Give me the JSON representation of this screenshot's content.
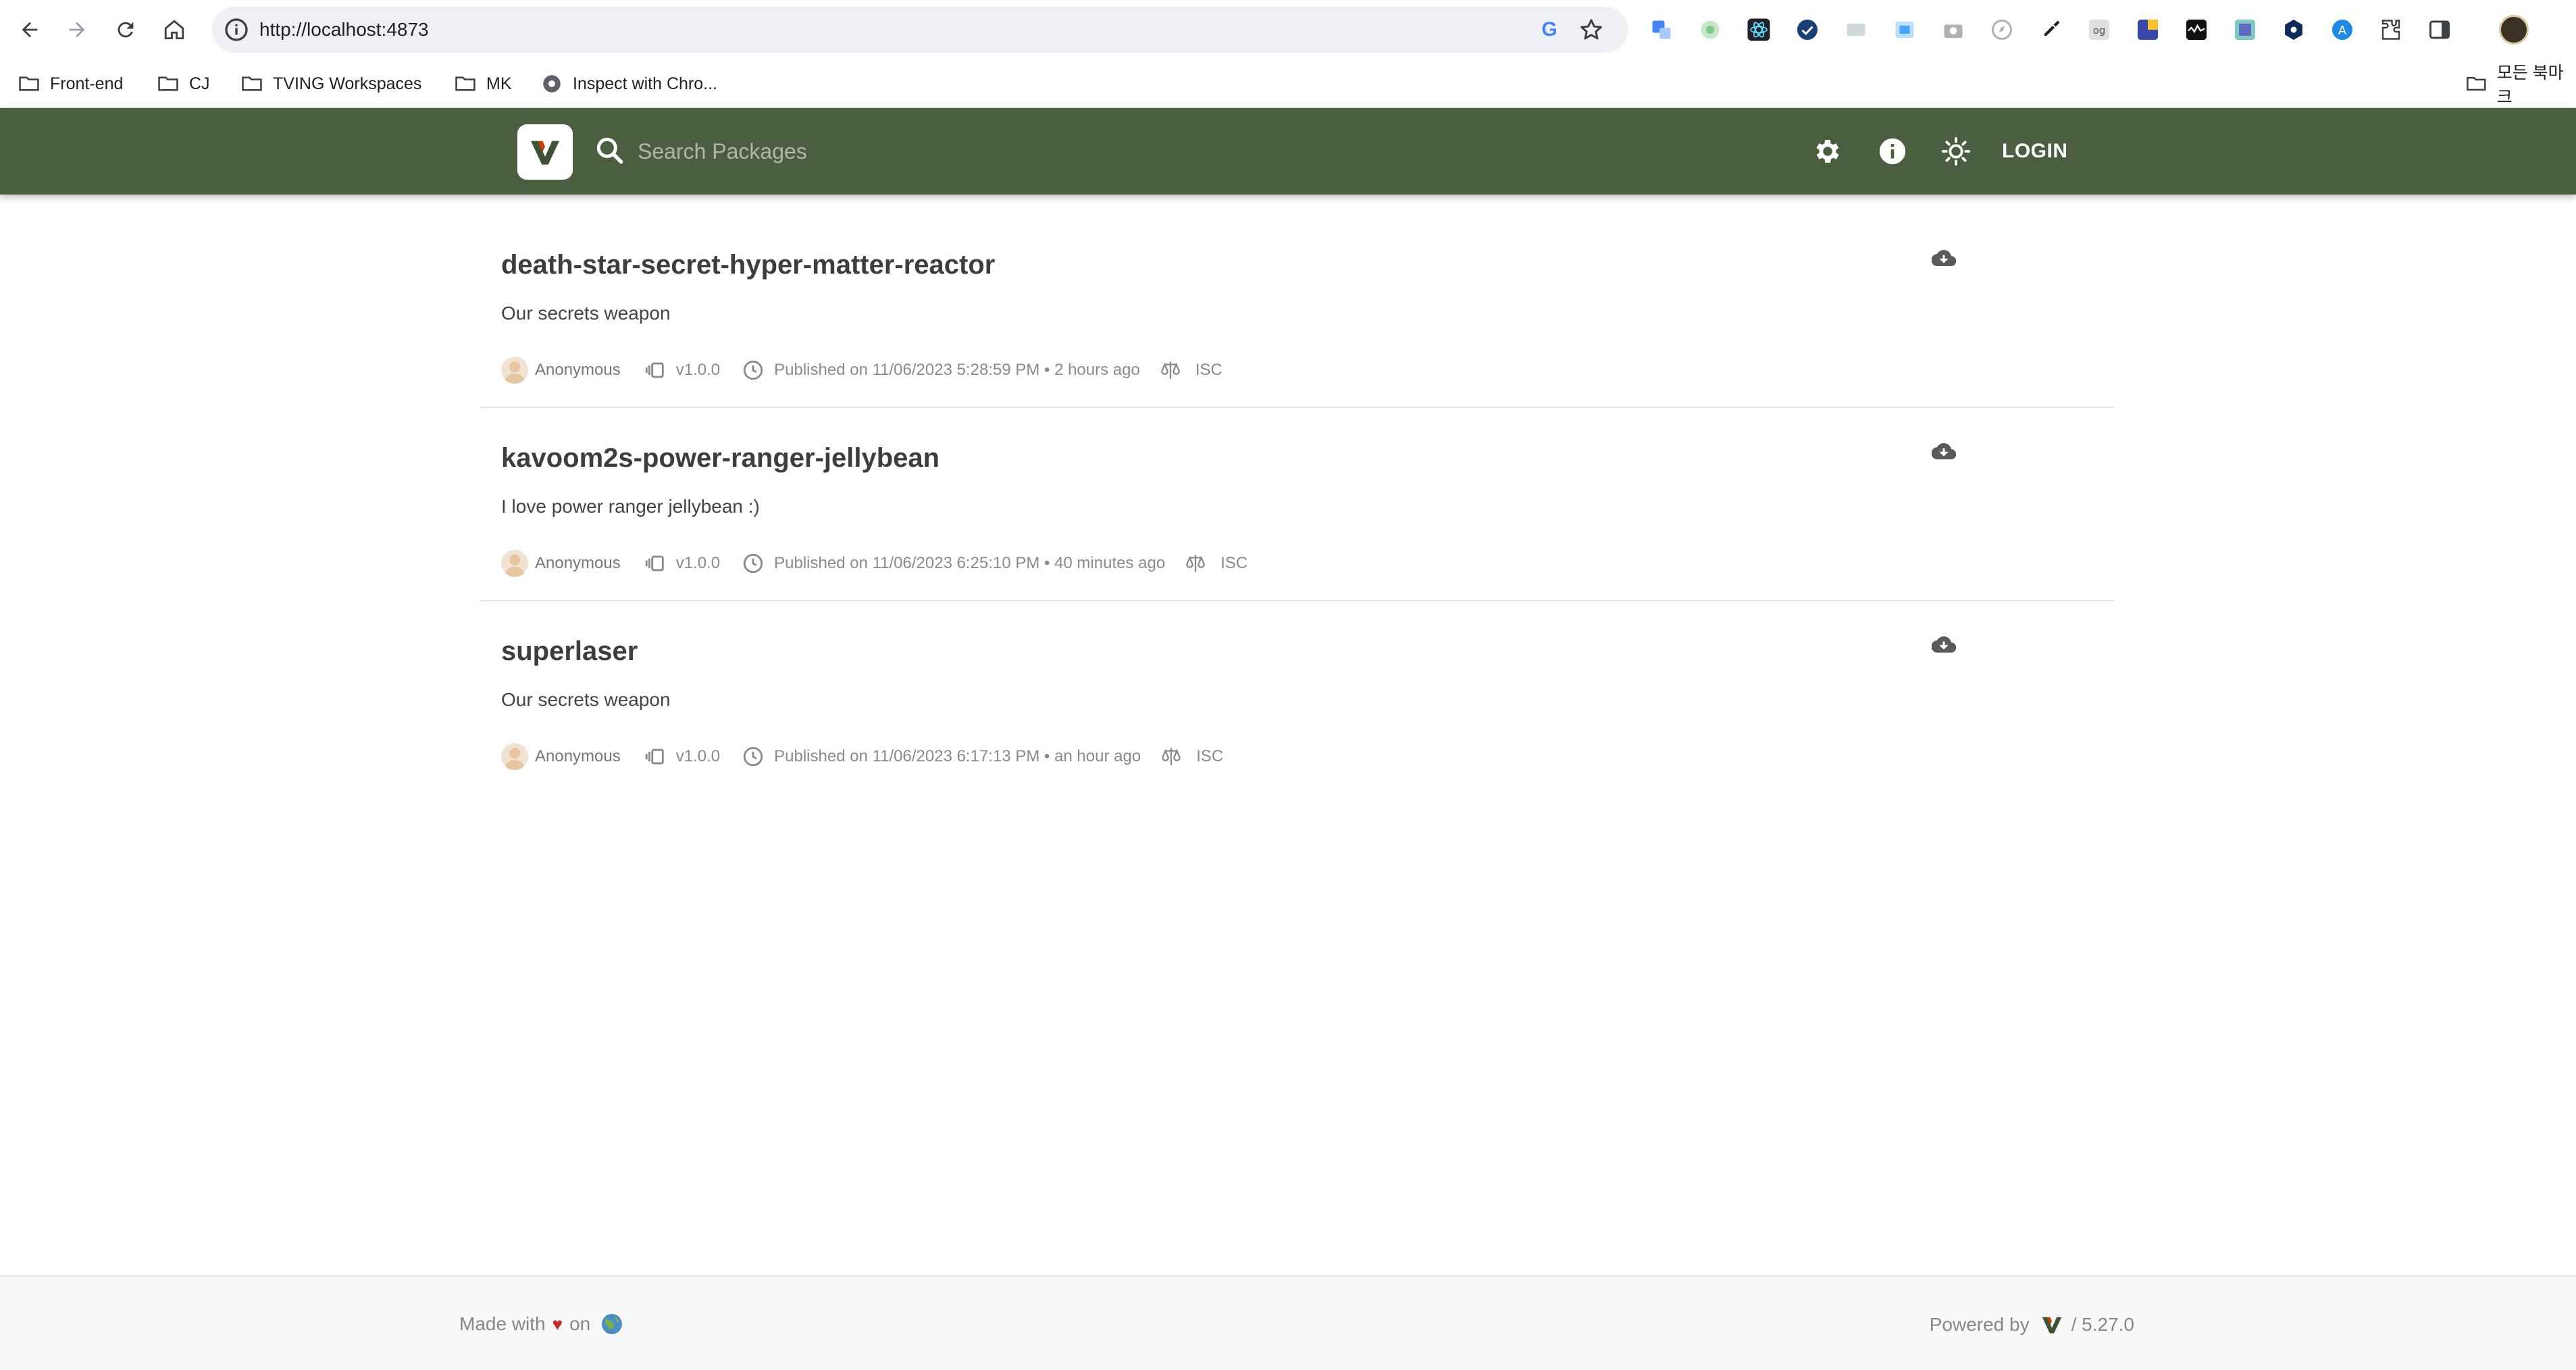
{
  "browser": {
    "url": "http://localhost:4873",
    "bookmarks": [
      {
        "label": "Front-end",
        "icon": "folder-icon"
      },
      {
        "label": "CJ",
        "icon": "folder-icon"
      },
      {
        "label": "TVING Workspaces",
        "icon": "folder-icon"
      },
      {
        "label": "MK",
        "icon": "folder-icon"
      },
      {
        "label": "Inspect with Chro...",
        "icon": "chrome-icon"
      }
    ],
    "all_bookmarks": "모든 북마크"
  },
  "header": {
    "search_placeholder": "Search Packages",
    "login_label": "LOGIN",
    "header_bg": "#4b5e40"
  },
  "packages": [
    {
      "name": "death-star-secret-hyper-matter-reactor",
      "description": "Our secrets weapon",
      "author": "Anonymous",
      "version": "v1.0.0",
      "published": "Published on 11/06/2023 5:28:59 PM • 2 hours ago",
      "license": "ISC"
    },
    {
      "name": "kavoom2s-power-ranger-jellybean",
      "description": "I love power ranger jellybean :)",
      "author": "Anonymous",
      "version": "v1.0.0",
      "published": "Published on 11/06/2023 6:25:10 PM • 40 minutes ago",
      "license": "ISC"
    },
    {
      "name": "superlaser",
      "description": "Our secrets weapon",
      "author": "Anonymous",
      "version": "v1.0.0",
      "published": "Published on 11/06/2023 6:17:13 PM • an hour ago",
      "license": "ISC"
    }
  ],
  "footer": {
    "made_with": "Made with",
    "heart": "♥",
    "on": "on",
    "powered_by": "Powered by",
    "version": "/ 5.27.0"
  }
}
